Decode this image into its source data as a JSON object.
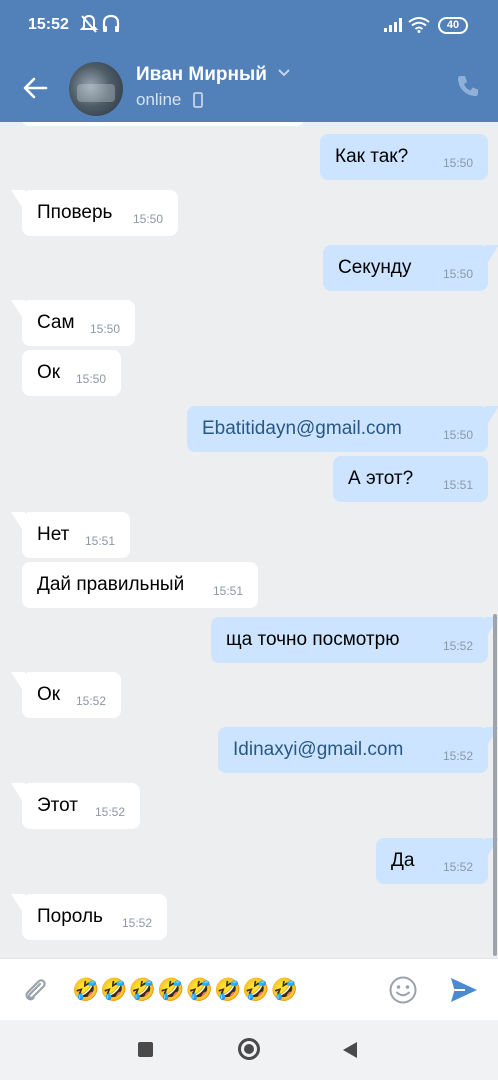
{
  "status_bar": {
    "time": "15:52",
    "battery": "40"
  },
  "contact": {
    "name": "Иван Мирный",
    "status": "online"
  },
  "messages": [
    {
      "dir": "out",
      "text": "Как так?",
      "time": "15:50"
    },
    {
      "dir": "in",
      "text": "Пповерь",
      "time": "15:50"
    },
    {
      "dir": "out",
      "text": "Секунду",
      "time": "15:50"
    },
    {
      "dir": "in",
      "text": "Сам",
      "time": "15:50"
    },
    {
      "dir": "in",
      "text": "Ок",
      "time": "15:50"
    },
    {
      "dir": "out",
      "text": "Ebatitidayn@gmail.com",
      "time": "15:50"
    },
    {
      "dir": "out",
      "text": "А этот?",
      "time": "15:51"
    },
    {
      "dir": "in",
      "text": "Нет",
      "time": "15:51"
    },
    {
      "dir": "in",
      "text": "Дай правильный",
      "time": "15:51"
    },
    {
      "dir": "out",
      "text": "ща точно посмотрю",
      "time": "15:52"
    },
    {
      "dir": "in",
      "text": "Ок",
      "time": "15:52"
    },
    {
      "dir": "out",
      "text": "Idinaxyi@gmail.com",
      "time": "15:52"
    },
    {
      "dir": "in",
      "text": "Этот",
      "time": "15:52"
    },
    {
      "dir": "out",
      "text": "Да",
      "time": "15:52"
    },
    {
      "dir": "in",
      "text": "Пороль",
      "time": "15:52"
    }
  ],
  "input": {
    "value": "🤣🤣🤣🤣🤣🤣🤣🤣"
  },
  "colors": {
    "header": "#5181b8",
    "incoming": "#ffffff",
    "outgoing": "#cce4ff",
    "background": "#edeef0",
    "link": "#2a5885"
  }
}
